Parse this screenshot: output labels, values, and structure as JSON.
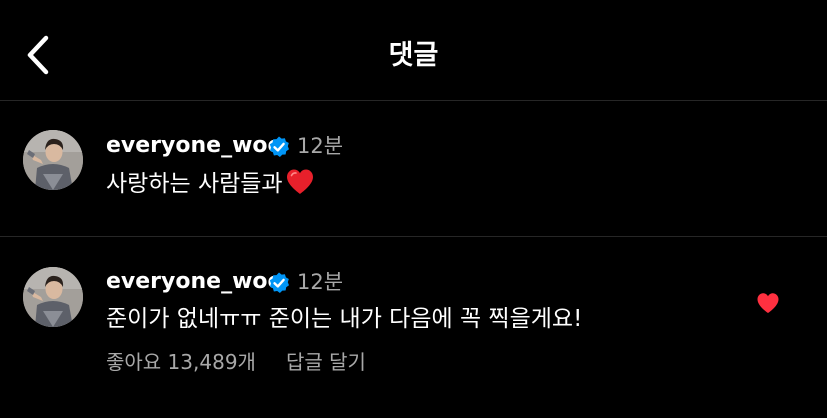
{
  "header": {
    "title": "댓글",
    "back_icon": "chevron-left-icon"
  },
  "comments": [
    {
      "username": "everyone_woo",
      "verified": true,
      "time": "12분",
      "text": "사랑하는 사람들과",
      "emoji": "heart-emoji",
      "liked": false
    },
    {
      "username": "everyone_woo",
      "verified": true,
      "time": "12분",
      "text": "준이가 없네ㅠㅠ 준이는 내가 다음에 꼭 찍을게요!",
      "liked": true,
      "likes_label": "좋아요 13,489개",
      "reply_label": "답글 달기"
    }
  ],
  "colors": {
    "background": "#000000",
    "text": "#ffffff",
    "secondary_text": "#a8a8a8",
    "verified_badge": "#0095f6",
    "like_red": "#ff3040",
    "divider": "#262626"
  }
}
